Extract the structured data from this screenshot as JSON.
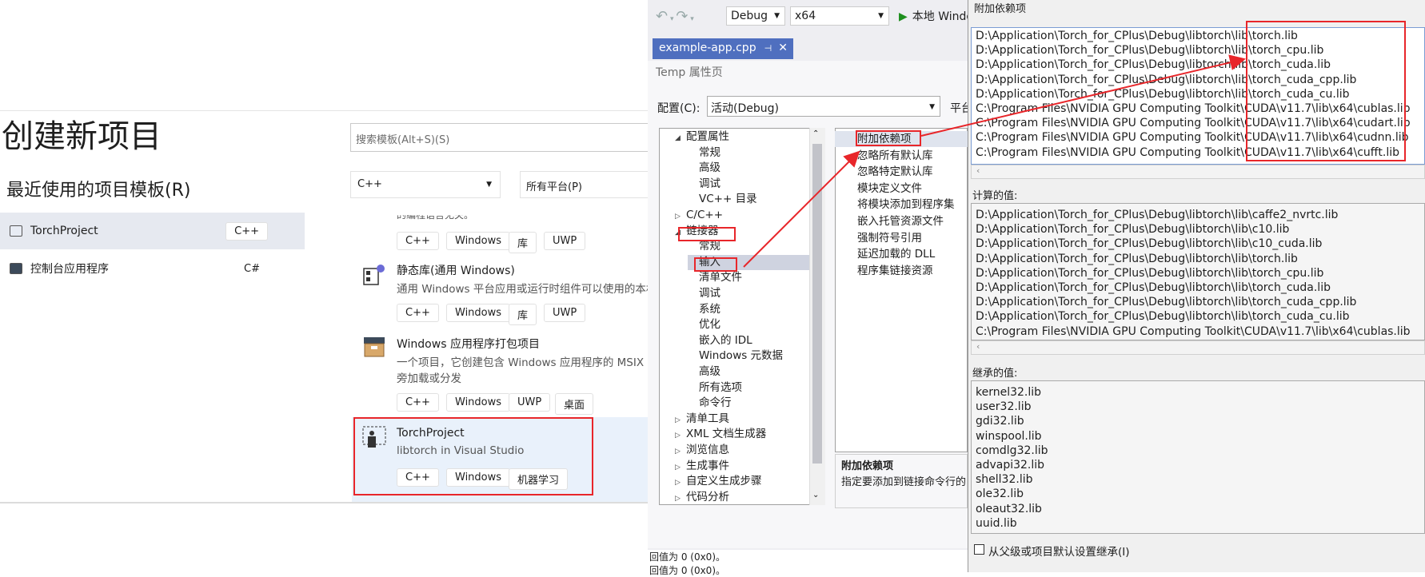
{
  "new_project": {
    "title": "创建新项目",
    "recent_heading": "最近使用的项目模板(R)",
    "recent": [
      {
        "name": "TorchProject",
        "lang": "C++",
        "icon": "project-template-icon"
      },
      {
        "name": "控制台应用程序",
        "lang": "C#",
        "icon": "console-app-icon"
      }
    ],
    "search_placeholder": "搜索模板(Alt+S)(S)",
    "language_filter": "C++",
    "platform_filter": "所有平台(P)",
    "partial_desc_top": "的编程语言无关。",
    "templates": [
      {
        "name": "",
        "desc": "",
        "tags": [
          "C++",
          "Windows",
          "库",
          "UWP"
        ]
      },
      {
        "name": "静态库(通用 Windows)",
        "desc": "通用 Windows 平台应用或运行时组件可以使用的本机",
        "tags": [
          "C++",
          "Windows",
          "库",
          "UWP"
        ]
      },
      {
        "name": "Windows 应用程序打包项目",
        "desc": "一个项目，它创建包含 Windows 应用程序的 MSIX 包",
        "desc2": "旁加载或分发",
        "tags": [
          "C++",
          "Windows",
          "UWP",
          "桌面"
        ]
      },
      {
        "name": "TorchProject",
        "desc": "libtorch in Visual Studio",
        "tags": [
          "C++",
          "Windows",
          "机器学习"
        ]
      }
    ]
  },
  "toolbar": {
    "config": "Debug",
    "platform": "x64",
    "run_label": "本地 Windo"
  },
  "doc_tab": {
    "label": "example-app.cpp",
    "pin": "⊣",
    "close": "✕"
  },
  "props": {
    "title": "Temp 属性页",
    "config_label": "配置(C):",
    "config_value": "活动(Debug)",
    "platform_label": "平台",
    "tree": [
      {
        "text": "配置属性",
        "tw": "◢"
      },
      {
        "text": "常规",
        "tw": ""
      },
      {
        "text": "高级",
        "tw": ""
      },
      {
        "text": "调试",
        "tw": ""
      },
      {
        "text": "VC++ 目录",
        "tw": ""
      },
      {
        "text": "C/C++",
        "tw": "▷"
      },
      {
        "text": "链接器",
        "tw": "◢"
      },
      {
        "text": "常规",
        "tw": ""
      },
      {
        "text": "输入",
        "tw": ""
      },
      {
        "text": "清单文件",
        "tw": ""
      },
      {
        "text": "调试",
        "tw": ""
      },
      {
        "text": "系统",
        "tw": ""
      },
      {
        "text": "优化",
        "tw": ""
      },
      {
        "text": "嵌入的 IDL",
        "tw": ""
      },
      {
        "text": "Windows 元数据",
        "tw": ""
      },
      {
        "text": "高级",
        "tw": ""
      },
      {
        "text": "所有选项",
        "tw": ""
      },
      {
        "text": "命令行",
        "tw": ""
      },
      {
        "text": "清单工具",
        "tw": "▷"
      },
      {
        "text": "XML 文档生成器",
        "tw": "▷"
      },
      {
        "text": "浏览信息",
        "tw": "▷"
      },
      {
        "text": "生成事件",
        "tw": "▷"
      },
      {
        "text": "自定义生成步骤",
        "tw": "▷"
      },
      {
        "text": "代码分析",
        "tw": "▷"
      }
    ],
    "grid": [
      "附加依赖项",
      "忽略所有默认库",
      "忽略特定默认库",
      "模块定义文件",
      "将模块添加到程序集",
      "嵌入托管资源文件",
      "强制符号引用",
      "延迟加载的 DLL",
      "程序集链接资源"
    ],
    "desc_title": "附加依赖项",
    "desc_text": "指定要添加到链接命令行的"
  },
  "output": {
    "line1": "回值为 0 (0x0)。",
    "line2": "回值为 0 (0x0)。"
  },
  "dialog": {
    "title": "附加依赖项",
    "deps": [
      "D:\\Application\\Torch_for_CPlus\\Debug\\libtorch\\lib\\torch.lib",
      "D:\\Application\\Torch_for_CPlus\\Debug\\libtorch\\lib\\torch_cpu.lib",
      "D:\\Application\\Torch_for_CPlus\\Debug\\libtorch\\lib\\torch_cuda.lib",
      "D:\\Application\\Torch_for_CPlus\\Debug\\libtorch\\lib\\torch_cuda_cpp.lib",
      "D:\\Application\\Torch_for_CPlus\\Debug\\libtorch\\lib\\torch_cuda_cu.lib",
      "C:\\Program Files\\NVIDIA GPU Computing Toolkit\\CUDA\\v11.7\\lib\\x64\\cublas.lib",
      "C:\\Program Files\\NVIDIA GPU Computing Toolkit\\CUDA\\v11.7\\lib\\x64\\cudart.lib",
      "C:\\Program Files\\NVIDIA GPU Computing Toolkit\\CUDA\\v11.7\\lib\\x64\\cudnn.lib",
      "C:\\Program Files\\NVIDIA GPU Computing Toolkit\\CUDA\\v11.7\\lib\\x64\\cufft.lib"
    ],
    "calc_label": "计算的值:",
    "calc": [
      "D:\\Application\\Torch_for_CPlus\\Debug\\libtorch\\lib\\caffe2_nvrtc.lib",
      "D:\\Application\\Torch_for_CPlus\\Debug\\libtorch\\lib\\c10.lib",
      "D:\\Application\\Torch_for_CPlus\\Debug\\libtorch\\lib\\c10_cuda.lib",
      "D:\\Application\\Torch_for_CPlus\\Debug\\libtorch\\lib\\torch.lib",
      "D:\\Application\\Torch_for_CPlus\\Debug\\libtorch\\lib\\torch_cpu.lib",
      "D:\\Application\\Torch_for_CPlus\\Debug\\libtorch\\lib\\torch_cuda.lib",
      "D:\\Application\\Torch_for_CPlus\\Debug\\libtorch\\lib\\torch_cuda_cpp.lib",
      "D:\\Application\\Torch_for_CPlus\\Debug\\libtorch\\lib\\torch_cuda_cu.lib",
      "C:\\Program Files\\NVIDIA GPU Computing Toolkit\\CUDA\\v11.7\\lib\\x64\\cublas.lib"
    ],
    "inherited_label": "继承的值:",
    "inherited": [
      "kernel32.lib",
      "user32.lib",
      "gdi32.lib",
      "winspool.lib",
      "comdlg32.lib",
      "advapi32.lib",
      "shell32.lib",
      "ole32.lib",
      "oleaut32.lib",
      "uuid.lib"
    ],
    "inherit_checkbox": "从父级或项目默认设置继承(I)",
    "scroll_left": "‹"
  },
  "colors": {
    "annotation_red": "#e8262a",
    "selection": "#cfe0f7",
    "tab_blue": "#4f6fbf"
  }
}
